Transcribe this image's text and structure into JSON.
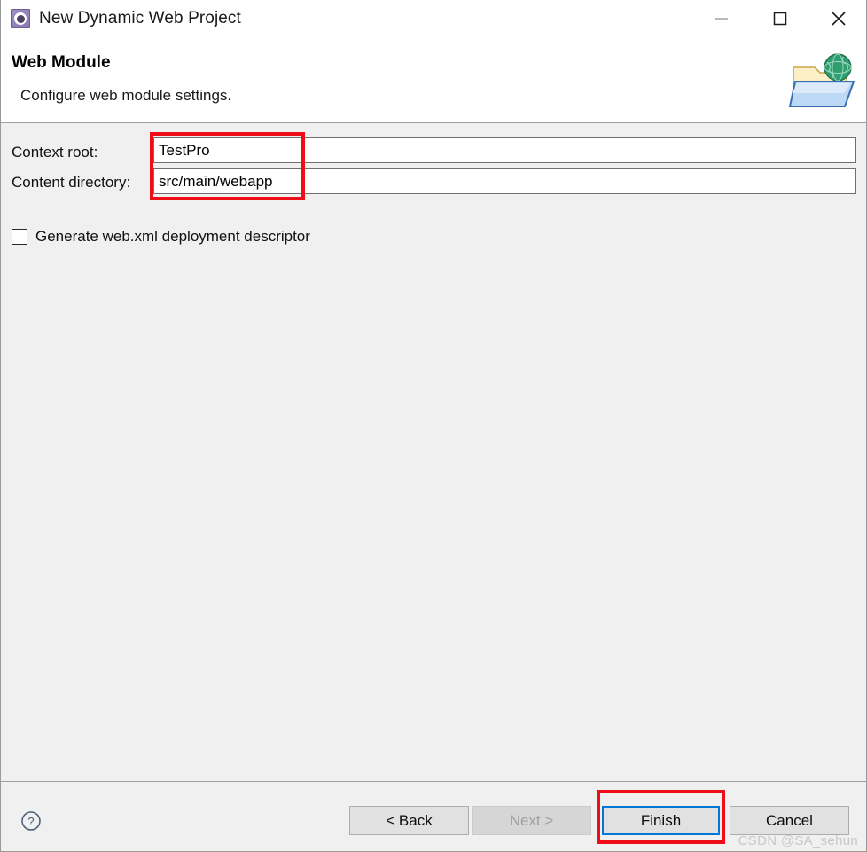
{
  "window": {
    "title": "New Dynamic Web Project",
    "icon": "eclipse-project-gear-icon",
    "controls": {
      "minimize": "minimize-icon",
      "maximize": "maximize-icon",
      "close": "close-icon"
    }
  },
  "header": {
    "title": "Web Module",
    "description": "Configure web module settings.",
    "banner_icon": "web-folder-globe-icon"
  },
  "form": {
    "fields": [
      {
        "id": "context-root",
        "label": "Context root:",
        "value": "TestPro",
        "placeholder": ""
      },
      {
        "id": "content-directory",
        "label": "Content directory:",
        "value": "src/main/webapp",
        "placeholder": ""
      }
    ],
    "checkbox": {
      "label": "Generate web.xml deployment descriptor",
      "checked": false
    }
  },
  "footer": {
    "help_icon": "help-question-icon",
    "buttons": [
      {
        "id": "back",
        "label": "< Back",
        "enabled": true,
        "default": false
      },
      {
        "id": "next",
        "label": "Next >",
        "enabled": false,
        "default": false
      },
      {
        "id": "finish",
        "label": "Finish",
        "enabled": true,
        "default": true
      },
      {
        "id": "cancel",
        "label": "Cancel",
        "enabled": true,
        "default": false
      }
    ],
    "watermark": "CSDN @SA_sehun"
  },
  "annotations": {
    "fields_highlight": "red-rectangle-around-input-fields",
    "finish_highlight": "red-rectangle-around-finish-button"
  },
  "colors": {
    "annotation_red": "#ef0d18",
    "focus_blue": "#0078d7",
    "dialog_bg": "#f0f0f0",
    "header_bg": "#ffffff"
  }
}
